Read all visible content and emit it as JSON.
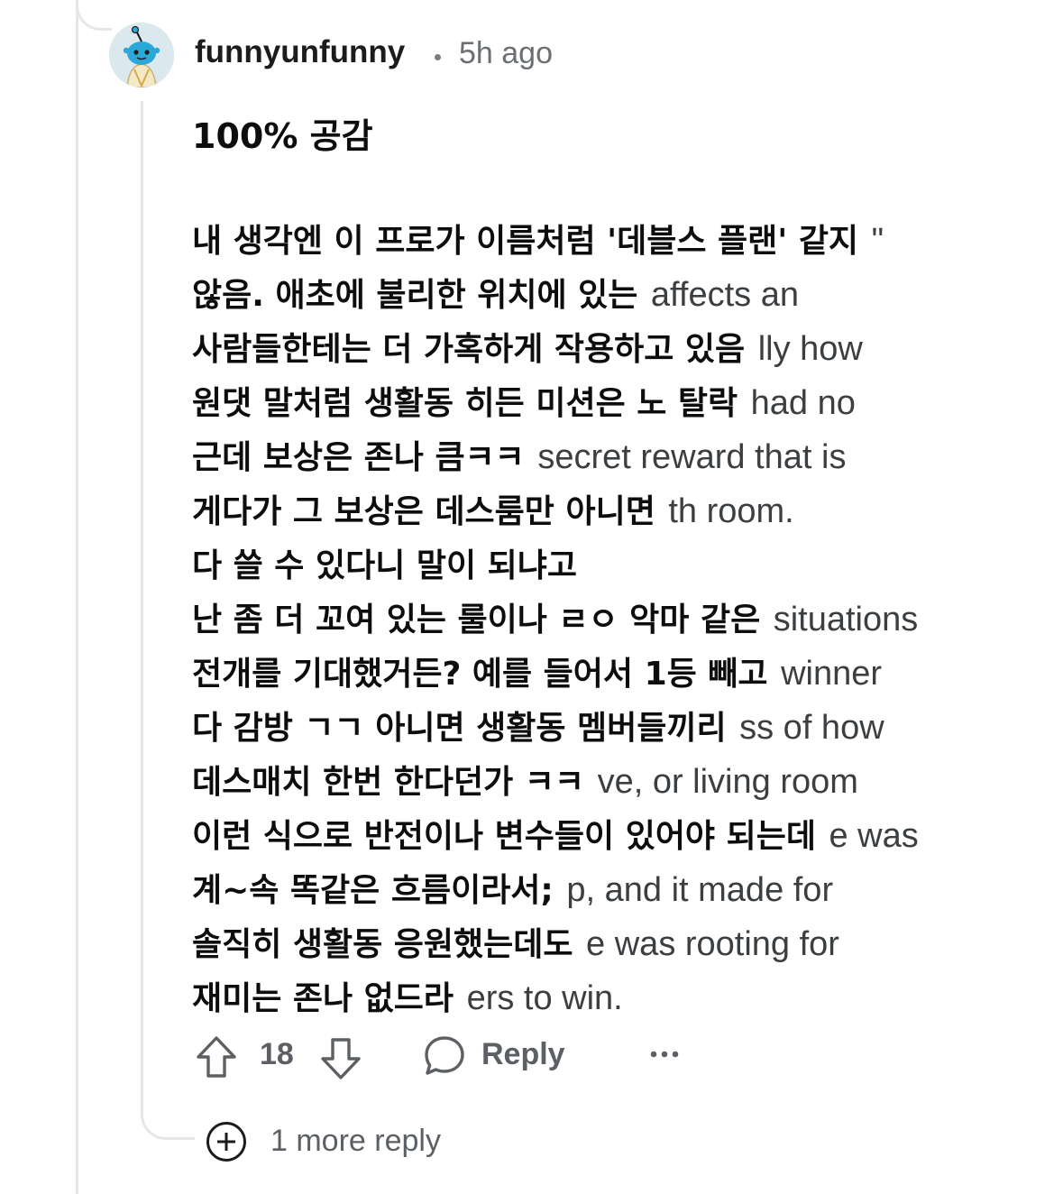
{
  "comment": {
    "username": "funnyunfunny",
    "separator": "•",
    "timestamp": "5h ago",
    "first_line": "100% 공감",
    "lines": [
      {
        "ko": "내 생각엔 이 프로가 이름처럼 '데블스 플랜' 같지 ",
        "en": "\""
      },
      {
        "ko": "않음. 애초에 불리한 위치에 있는 ",
        "en": "affects an"
      },
      {
        "ko": "사람들한테는 더 가혹하게 작용하고 있음 ",
        "en": "lly how"
      },
      {
        "ko": "원댓 말처럼 생활동 히든 미션은 노 탈락 ",
        "en": "had no"
      },
      {
        "ko": "근데 보상은 존나 큼ㅋㅋ ",
        "en": "secret reward that is"
      },
      {
        "ko": "게다가 그 보상은 데스룸만 아니면 ",
        "en": "th room."
      },
      {
        "ko": "다 쓸 수 있다니 말이 되냐고",
        "en": ""
      },
      {
        "ko": "난 좀 더 꼬여 있는 룰이나 ㄹㅇ 악마 같은 ",
        "en": "situations"
      },
      {
        "ko": "전개를 기대했거든? 예를 들어서 1등 빼고 ",
        "en": "winner"
      },
      {
        "ko": "다 감방 ㄱㄱ 아니면 생활동 멤버들끼리 ",
        "en": "ss of how"
      },
      {
        "ko": "데스매치 한번 한다던가 ㅋㅋ ",
        "en": "ve, or living room"
      },
      {
        "ko": "이런 식으로 반전이나 변수들이 있어야 되는데 ",
        "en": "e was"
      },
      {
        "ko": "계~속 똑같은 흐름이라서; ",
        "en": "p, and it made for"
      },
      {
        "ko": "솔직히 생활동 응원했는데도 ",
        "en": "e was rooting for"
      },
      {
        "ko": "재미는 존나 없드라 ",
        "en": "ers to win."
      }
    ]
  },
  "actions": {
    "upvote_icon": "arrow-up-icon",
    "score": "18",
    "downvote_icon": "arrow-down-icon",
    "reply_icon": "speech-bubble-icon",
    "reply_label": "Reply",
    "more_icon": "ellipsis-icon"
  },
  "more_replies": {
    "icon": "plus-circle-icon",
    "label": "1 more reply"
  },
  "colors": {
    "thread_line": "#e4e6e8",
    "meta_text": "#6b6f73",
    "action_text": "#5c6064",
    "avatar_blue": "#2aa8d8"
  }
}
